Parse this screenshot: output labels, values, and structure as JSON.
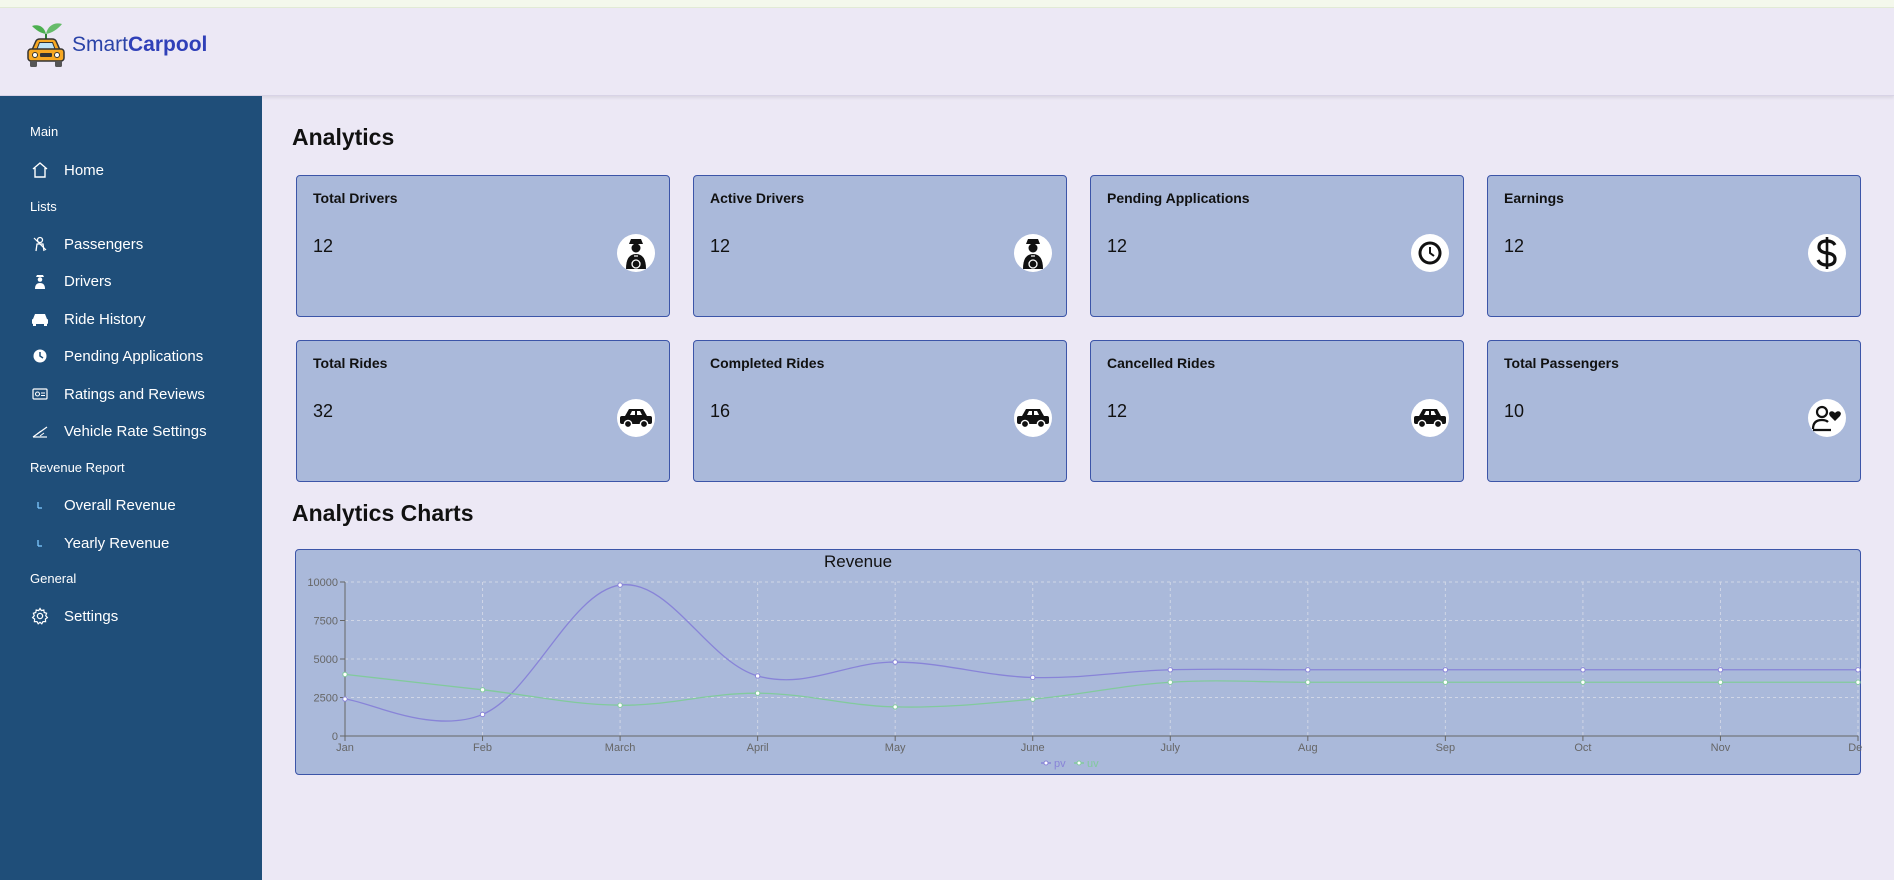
{
  "app": {
    "name_part1": "Smart",
    "name_part2": "Carpool"
  },
  "sidebar": {
    "sections": [
      {
        "title": "Main",
        "items": [
          {
            "label": "Home",
            "icon": "home-icon"
          }
        ]
      },
      {
        "title": "Lists",
        "items": [
          {
            "label": "Passengers",
            "icon": "passenger-icon"
          },
          {
            "label": "Drivers",
            "icon": "driver-icon"
          },
          {
            "label": "Ride History",
            "icon": "car-icon"
          },
          {
            "label": "Pending Applications",
            "icon": "clock-icon"
          },
          {
            "label": "Ratings and Reviews",
            "icon": "rating-icon"
          },
          {
            "label": "Vehicle Rate Settings",
            "icon": "rate-icon"
          }
        ]
      },
      {
        "title": "Revenue Report",
        "items": [
          {
            "label": "Overall Revenue",
            "icon": "revenue-icon"
          },
          {
            "label": "Yearly Revenue",
            "icon": "revenue-icon"
          }
        ]
      },
      {
        "title": "General",
        "items": [
          {
            "label": "Settings",
            "icon": "gear-icon"
          }
        ]
      }
    ]
  },
  "analytics": {
    "title": "Analytics",
    "cards": [
      {
        "title": "Total Drivers",
        "value": "12",
        "icon": "driver-icon"
      },
      {
        "title": "Active Drivers",
        "value": "12",
        "icon": "driver-icon"
      },
      {
        "title": "Pending Applications",
        "value": "12",
        "icon": "clock-icon"
      },
      {
        "title": "Earnings",
        "value": "12",
        "icon": "dollar-icon"
      },
      {
        "title": "Total Rides",
        "value": "32",
        "icon": "car-icon"
      },
      {
        "title": "Completed Rides",
        "value": "16",
        "icon": "car-icon"
      },
      {
        "title": "Cancelled Rides",
        "value": "12",
        "icon": "car-icon"
      },
      {
        "title": "Total Passengers",
        "value": "10",
        "icon": "passenger-heart-icon"
      }
    ]
  },
  "charts_section": {
    "title": "Analytics Charts"
  },
  "chart_data": {
    "type": "line",
    "title": "Revenue",
    "categories": [
      "Jan",
      "Feb",
      "March",
      "April",
      "May",
      "June",
      "July",
      "Aug",
      "Sep",
      "Oct",
      "Nov",
      "Dec"
    ],
    "yticks": [
      "0",
      "2500",
      "5000",
      "7500",
      "10000"
    ],
    "ylim": [
      0,
      10000
    ],
    "grid": true,
    "legend_position": "bottom",
    "series": [
      {
        "name": "pv",
        "color": "#8884d8",
        "values": [
          2400,
          1400,
          9800,
          3900,
          4800,
          3800,
          4300,
          4300,
          4300,
          4300,
          4300,
          4300
        ]
      },
      {
        "name": "uv",
        "color": "#82ca9d",
        "values": [
          4000,
          3000,
          2000,
          2780,
          1890,
          2390,
          3490,
          3490,
          3490,
          3490,
          3490,
          3490
        ]
      }
    ]
  }
}
